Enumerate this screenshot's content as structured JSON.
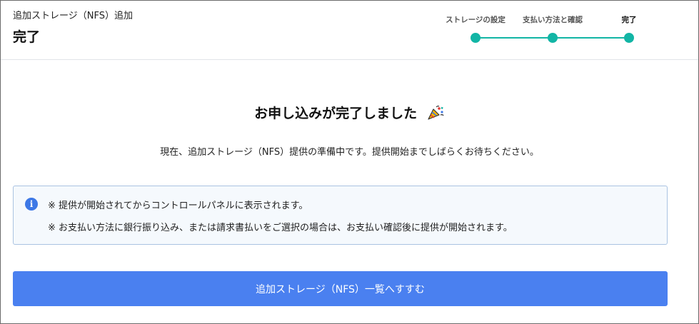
{
  "header": {
    "subtitle": "追加ストレージ（NFS）追加",
    "title": "完了"
  },
  "stepper": {
    "steps": [
      {
        "label": "ストレージの設定",
        "state": "done"
      },
      {
        "label": "支払い方法と確認",
        "state": "done"
      },
      {
        "label": "完了",
        "state": "current"
      }
    ],
    "accent_color": "#12b5a5"
  },
  "main": {
    "heading": "お申し込みが完了しました",
    "heading_icon": "party-popper-icon",
    "description": "現在、追加ストレージ（NFS）提供の準備中です。提供開始までしばらくお待ちください。"
  },
  "notice": {
    "icon": "info-icon",
    "lines": [
      "※ 提供が開始されてからコントロールパネルに表示されます。",
      "※ お支払い方法に銀行振り込み、または請求書払いをご選択の場合は、お支払い確認後に提供が開始されます。"
    ]
  },
  "actions": {
    "primary_label": "追加ストレージ（NFS）一覧へすすむ",
    "primary_color": "#4a80f0"
  }
}
